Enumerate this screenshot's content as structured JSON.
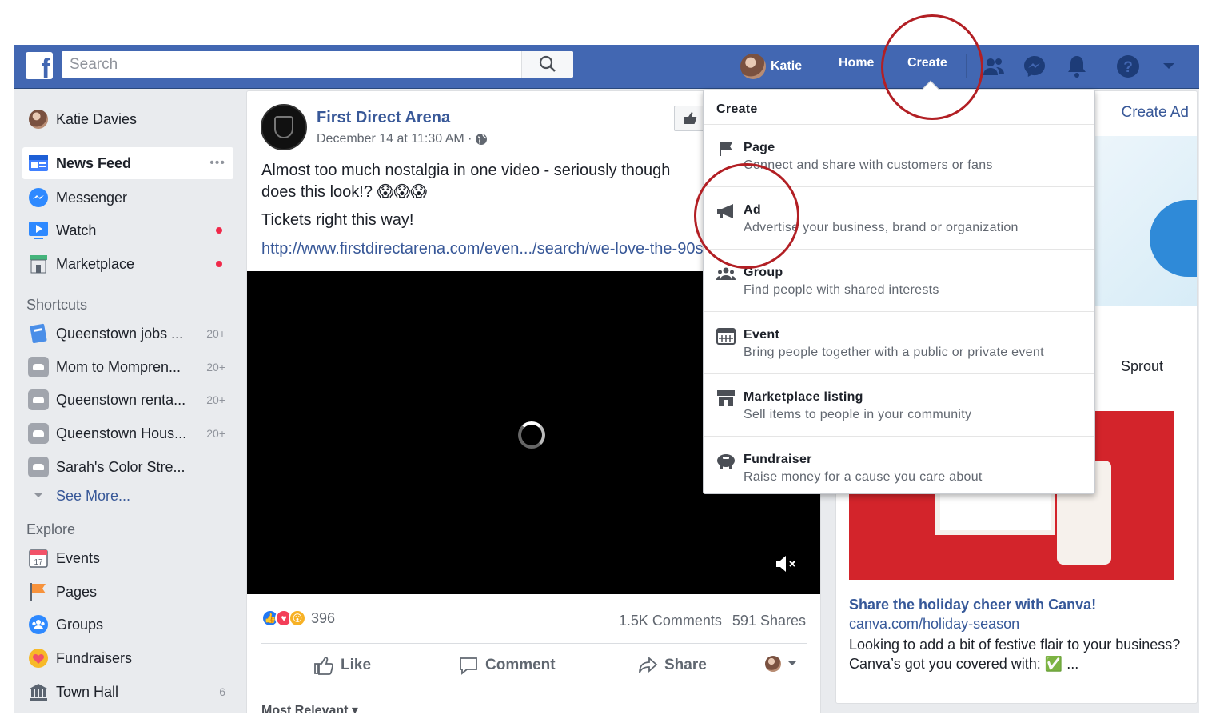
{
  "topbar": {
    "logo": "f",
    "search_placeholder": "Search",
    "profile_name": "Katie",
    "home_label": "Home",
    "create_label": "Create"
  },
  "icons": {
    "search": "search-icon",
    "friend_requests": "friends-icon",
    "messenger": "messenger-icon",
    "notifications": "bell-icon",
    "help": "help-icon",
    "account_menu": "caret-down-icon"
  },
  "sidebar": {
    "profile_name": "Katie Davies",
    "main_items": [
      {
        "label": "News Feed",
        "icon": "news-feed-icon"
      },
      {
        "label": "Messenger",
        "icon": "messenger-icon"
      },
      {
        "label": "Watch",
        "icon": "watch-icon"
      },
      {
        "label": "Marketplace",
        "icon": "marketplace-icon"
      }
    ],
    "shortcuts_heading": "Shortcuts",
    "shortcuts": [
      {
        "label": "Queenstown jobs ...",
        "count": "20+"
      },
      {
        "label": "Mom to Mompren...",
        "count": "20+"
      },
      {
        "label": "Queenstown renta...",
        "count": "20+"
      },
      {
        "label": "Queenstown Hous...",
        "count": "20+"
      },
      {
        "label": "Sarah's Color Stre..."
      }
    ],
    "see_more": "See More...",
    "explore_heading": "Explore",
    "explore": [
      {
        "label": "Events",
        "icon": "calendar-icon"
      },
      {
        "label": "Pages",
        "icon": "flag-icon"
      },
      {
        "label": "Groups",
        "icon": "groups-icon"
      },
      {
        "label": "Fundraisers",
        "icon": "fundraiser-icon"
      },
      {
        "label": "Town Hall",
        "icon": "town-hall-icon",
        "count": "6"
      }
    ]
  },
  "post": {
    "page_name": "First Direct Arena",
    "timestamp": "December 14 at 11:30 AM ·",
    "text": "Almost too much nostalgia in one video - seriously though does this look!? 😱😱😱",
    "text2": "Tickets right this way!",
    "link": "http://www.firstdirectarena.com/even.../search/we-love-the-90s",
    "reaction_count": "396",
    "comments": "1.5K Comments",
    "shares": "591 Shares",
    "like_label": "Like",
    "comment_label": "Comment",
    "share_label": "Share",
    "sort_label": "Most Relevant ▾"
  },
  "right_rail": {
    "create_ad": "Create Ad",
    "sprout_fragment": "Sprout",
    "ad_title": "Share the holiday cheer with Canva!",
    "ad_url": "canva.com/holiday-season",
    "ad_desc": "Looking to add a bit of festive flair to your business? Canva’s got you covered with: ✅ ..."
  },
  "create_menu": {
    "header": "Create",
    "items": [
      {
        "title": "Page",
        "desc": "Connect and share with customers or fans",
        "icon": "flag-icon"
      },
      {
        "title": "Ad",
        "desc": "Advertise your business, brand or organization",
        "icon": "megaphone-icon"
      },
      {
        "title": "Group",
        "desc": "Find people with shared interests",
        "icon": "group-icon"
      },
      {
        "title": "Event",
        "desc": "Bring people together with a public or private event",
        "icon": "calendar-icon"
      },
      {
        "title": "Marketplace listing",
        "desc": "Sell items to people in your community",
        "icon": "storefront-icon"
      },
      {
        "title": "Fundraiser",
        "desc": "Raise money for a cause you care about",
        "icon": "piggy-bank-icon"
      }
    ]
  },
  "colors": {
    "brand_blue": "#4267b2",
    "link_blue": "#385898",
    "annotation_red": "#b21f24",
    "notification_dot": "#f02849"
  }
}
